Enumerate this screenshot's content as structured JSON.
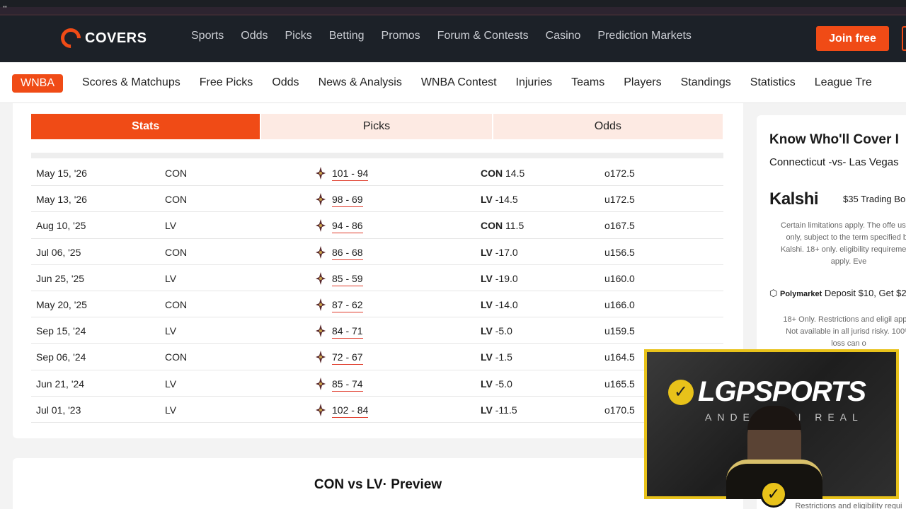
{
  "brand": {
    "name": "COVERS"
  },
  "main_nav": {
    "items": [
      "Sports",
      "Odds",
      "Picks",
      "Betting",
      "Promos",
      "Forum & Contests",
      "Casino",
      "Prediction Markets"
    ],
    "join_label": "Join free"
  },
  "sub_nav": {
    "league": "WNBA",
    "items": [
      "Scores & Matchups",
      "Free Picks",
      "Odds",
      "News & Analysis",
      "WNBA Contest",
      "Injuries",
      "Teams",
      "Players",
      "Standings",
      "Statistics",
      "League Tre"
    ]
  },
  "tabs": {
    "stats": "Stats",
    "picks": "Picks",
    "odds": "Odds"
  },
  "matchups": [
    {
      "date": "May 15, '26",
      "team": "CON",
      "score": "101 - 94",
      "line_team": "CON",
      "line": "14.5",
      "ou": "o172.5"
    },
    {
      "date": "May 13, '26",
      "team": "CON",
      "score": "98 - 69",
      "line_team": "LV",
      "line": "-14.5",
      "ou": "u172.5"
    },
    {
      "date": "Aug 10, '25",
      "team": "LV",
      "score": "94 - 86",
      "line_team": "CON",
      "line": "11.5",
      "ou": "o167.5"
    },
    {
      "date": "Jul 06, '25",
      "team": "CON",
      "score": "86 - 68",
      "line_team": "LV",
      "line": "-17.0",
      "ou": "u156.5"
    },
    {
      "date": "Jun 25, '25",
      "team": "LV",
      "score": "85 - 59",
      "line_team": "LV",
      "line": "-19.0",
      "ou": "u160.0"
    },
    {
      "date": "May 20, '25",
      "team": "CON",
      "score": "87 - 62",
      "line_team": "LV",
      "line": "-14.0",
      "ou": "u166.0"
    },
    {
      "date": "Sep 15, '24",
      "team": "LV",
      "score": "84 - 71",
      "line_team": "LV",
      "line": "-5.0",
      "ou": "u159.5"
    },
    {
      "date": "Sep 06, '24",
      "team": "CON",
      "score": "72 - 67",
      "line_team": "LV",
      "line": "-1.5",
      "ou": "u164.5"
    },
    {
      "date": "Jun 21, '24",
      "team": "LV",
      "score": "85 - 74",
      "line_team": "LV",
      "line": "-5.0",
      "ou": "u165.5"
    },
    {
      "date": "Jul 01, '23",
      "team": "LV",
      "score": "102 - 84",
      "line_team": "LV",
      "line": "-11.5",
      "ou": "o170.5"
    }
  ],
  "preview": {
    "title": "CON vs LV· Preview"
  },
  "sidebar": {
    "title": "Know Who'll Cover I",
    "matchup": "Connecticut -vs- Las Vegas",
    "kalshi": {
      "name": "Kalshi",
      "offer": "$35 Trading Bo",
      "fine": "Certain limitations apply. The offe users only, subject to the term specified by Kalshi. 18+ only. eligibility requirements apply. Eve"
    },
    "polymarket": {
      "name": "Polymarket",
      "offer": "Deposit $10, Get $2",
      "fine": "18+ Only. Restrictions and eligil apply. Not available in all jurisd risky. 100% loss can o"
    },
    "footer_fine": "Restrictions and eligibility requi"
  },
  "webcam": {
    "brand": "LGPSPORTS",
    "tagline": "ANDERSON REAL"
  },
  "icons": {
    "team_logo": "wnba-logo-icon",
    "check": "check-icon"
  },
  "colors": {
    "accent": "#f04b16",
    "nav_bg": "#1c2128",
    "tab_light": "#fdeae3",
    "score_underline": "#e03a2a",
    "webcam_border": "#e8c21a"
  }
}
